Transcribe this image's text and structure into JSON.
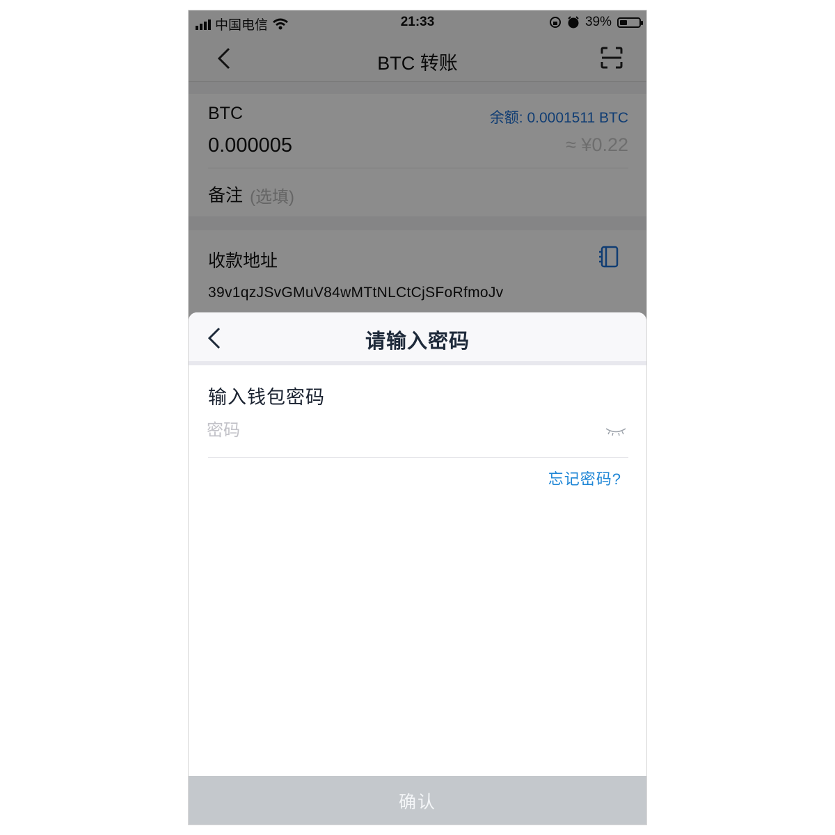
{
  "status_bar": {
    "carrier": "中国电信",
    "time": "21:33",
    "battery_text": "39%",
    "battery_level": 0.39
  },
  "nav": {
    "title": "BTC 转账",
    "back_icon": "chevron-left-icon",
    "scan_icon": "scan-icon"
  },
  "transfer": {
    "coin": "BTC",
    "balance_text": "余额: 0.0001511 BTC",
    "amount": "0.000005",
    "fiat": "≈ ¥0.22",
    "memo_label": "备注",
    "memo_placeholder": "(选填)",
    "address_label": "收款地址",
    "address_value": "39v1qzJSvGMuV84wMTtNLCtCjSFoRfmoJv"
  },
  "password_sheet": {
    "title": "请输入密码",
    "label": "输入钱包密码",
    "placeholder": "密码",
    "forgot_link": "忘记密码?",
    "confirm_button": "确认"
  },
  "colors": {
    "accent_blue": "#1e6fd1",
    "link_blue": "#1e86d6",
    "disabled_button": "#c4c8cc"
  }
}
